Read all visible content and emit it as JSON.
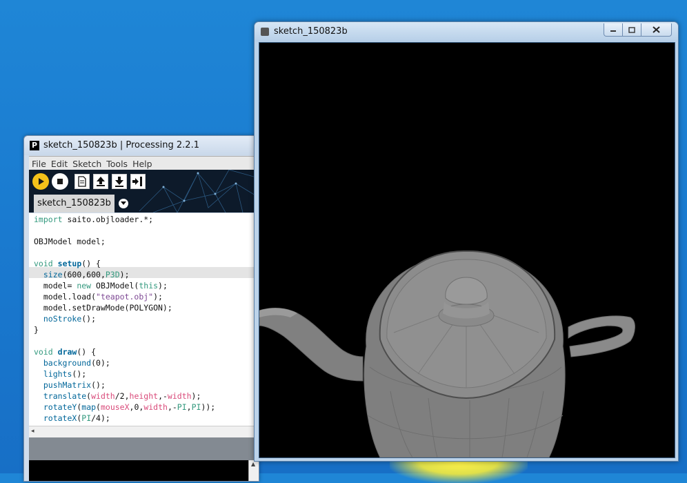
{
  "ide": {
    "title": "sketch_150823b | Processing 2.2.1",
    "logo": "P",
    "menu": [
      "File",
      "Edit",
      "Sketch",
      "Tools",
      "Help"
    ],
    "toolbar_icons": [
      "run-icon",
      "stop-icon",
      "new-icon",
      "open-icon",
      "save-icon",
      "export-icon"
    ],
    "tab_label": "sketch_150823b",
    "tab_menu_icon": "chevron-down-icon"
  },
  "sketch_window": {
    "title": "sketch_150823b",
    "controls": [
      "minimize",
      "maximize",
      "close"
    ]
  },
  "colors": {
    "run_button": "#f4c21a",
    "editor_highlight": "#e4e4e4",
    "keyword": "#33997e",
    "function": "#006699",
    "string": "#7d4793",
    "variable": "#d94a7a",
    "canvas_background": "#000000"
  }
}
